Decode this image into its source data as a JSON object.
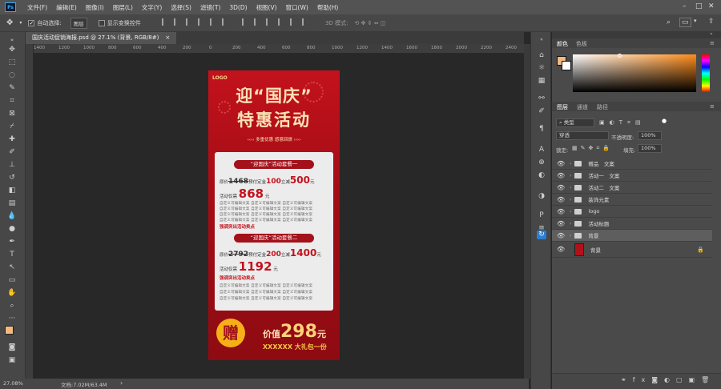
{
  "app": {
    "logo": "Ps"
  },
  "menu": [
    "文件(F)",
    "编辑(E)",
    "图像(I)",
    "图层(L)",
    "文字(Y)",
    "选择(S)",
    "滤镜(T)",
    "3D(D)",
    "视图(V)",
    "窗口(W)",
    "帮助(H)"
  ],
  "options": {
    "auto_select_label": "自动选择:",
    "auto_select_value": "图层",
    "show_transform_label": "显示变换控件",
    "mode_3d_label": "3D 模式:"
  },
  "document": {
    "tab_title": "国庆活动促销海报.psd @ 27.1% (背景, RGB/8#)"
  },
  "rulers": [
    "1400",
    "1200",
    "1000",
    "800",
    "600",
    "400",
    "200",
    "0",
    "200",
    "400",
    "600",
    "800",
    "1000",
    "1200",
    "1400",
    "1600",
    "1800",
    "2000",
    "2200",
    "2400"
  ],
  "status": {
    "zoom": "27.08%",
    "doc_size": "文档:7.02M/63.4M"
  },
  "color_panel": {
    "tab1": "颜色",
    "tab2": "色板",
    "fg_color": "#f5b97f",
    "accent": "#ff8c1a"
  },
  "layers_panel": {
    "tabs": [
      "图层",
      "通道",
      "路径"
    ],
    "filter_label": "类型",
    "blend_mode": "穿透",
    "opacity_label": "不透明度:",
    "opacity_value": "100%",
    "lock_label": "锁定:",
    "fill_label": "填充:",
    "fill_value": "100%",
    "layers": [
      {
        "name": "赠品　文案"
      },
      {
        "name": "活动一　文案"
      },
      {
        "name": "活动二　文案"
      },
      {
        "name": "装饰元素"
      },
      {
        "name": "logo"
      },
      {
        "name": "活动标题"
      },
      {
        "name": "背景"
      }
    ],
    "bg_layer": {
      "name": "背景"
    }
  },
  "poster": {
    "logo": "LOGO",
    "title1": "迎“国庆”",
    "title2": "特惠活动",
    "subtitle": "‹‹‹‹ 多重优惠  感恩回馈 ››››",
    "pkg1": {
      "pill": "“迎国庆”活动套餐一",
      "orig_label": "原价",
      "orig": "1468",
      "pre_label": "预付定金",
      "deposit": "100",
      "red_label": "立减",
      "reduction": "500",
      "unit": "元",
      "act_label": "活动仅需",
      "act_price": "868",
      "act_unit": "元",
      "feature": "强调突出活动卖点"
    },
    "pkg2": {
      "pill": "“迎国庆”活动套餐二",
      "orig_label": "原价",
      "orig": "2792",
      "pre_label": "预付定金",
      "deposit": "200",
      "red_label": "立减",
      "reduction": "1400",
      "unit": "元",
      "act_label": "活动仅需",
      "act_price": "1192",
      "act_unit": "元",
      "feature": "强调突出活动卖点"
    },
    "filler": "自定义可编辑文案 自定义可编辑文案 自定义可编辑文案",
    "gift_char": "赠",
    "gift_label": "价值",
    "gift_value": "298",
    "gift_unit": "元",
    "gift_desc": "XXXXXX 大礼包一份"
  }
}
